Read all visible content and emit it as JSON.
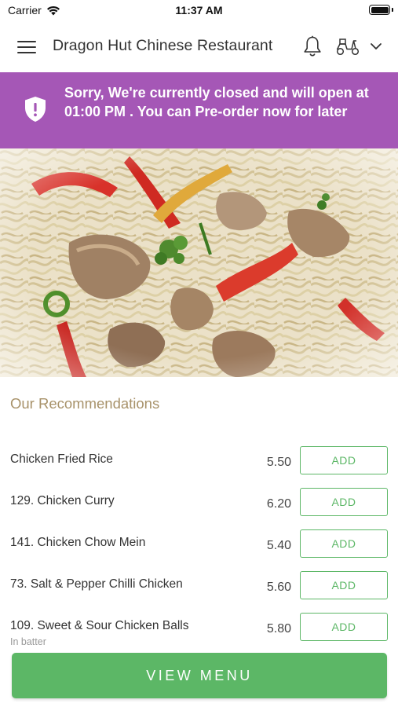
{
  "status_bar": {
    "carrier": "Carrier",
    "time": "11:37 AM"
  },
  "header": {
    "title": "Dragon Hut Chinese Restaurant",
    "icons": [
      "menu-icon",
      "bell-icon",
      "scooter-icon",
      "chevron-down-icon"
    ]
  },
  "banner": {
    "message": "Sorry, We're currently closed and will open at 01:00 PM . You can Pre-order now for later",
    "background": "#a557b6",
    "icon": "shield-alert-icon"
  },
  "recommendations": {
    "title": "Our Recommendations",
    "items": [
      {
        "name": "Chicken Fried Rice",
        "subtitle": "",
        "price": "5.50",
        "action": "ADD"
      },
      {
        "name": "129. Chicken Curry",
        "subtitle": "",
        "price": "6.20",
        "action": "ADD"
      },
      {
        "name": "141. Chicken Chow Mein",
        "subtitle": "",
        "price": "5.40",
        "action": "ADD"
      },
      {
        "name": "73. Salt & Pepper Chilli Chicken",
        "subtitle": "",
        "price": "5.60",
        "action": "ADD"
      },
      {
        "name": "109. Sweet & Sour Chicken Balls",
        "subtitle": "In batter",
        "price": "5.80",
        "action": "ADD"
      }
    ]
  },
  "footer": {
    "view_menu_label": "VIEW MENU"
  },
  "colors": {
    "accent_green": "#5cb766",
    "banner_purple": "#a557b6",
    "section_title": "#a8926a"
  }
}
